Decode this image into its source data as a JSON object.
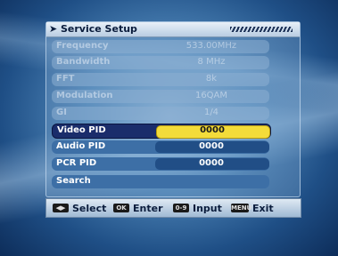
{
  "menu": {
    "title": "Service Setup",
    "rows": [
      {
        "label": "Frequency",
        "value": "533.00MHz"
      },
      {
        "label": "Bandwidth",
        "value": "8 MHz"
      },
      {
        "label": "FFT",
        "value": "8k"
      },
      {
        "label": "Modulation",
        "value": "16QAM"
      },
      {
        "label": "GI",
        "value": "1/4"
      },
      {
        "label": "Video PID",
        "value": "0000"
      },
      {
        "label": "Audio PID",
        "value": "0000"
      },
      {
        "label": "PCR PID",
        "value": "0000"
      },
      {
        "label": "Search",
        "value": ""
      }
    ],
    "selected_row": "Video PID"
  },
  "footer": {
    "hints": [
      {
        "key": "arrows-icon",
        "label": "Select"
      },
      {
        "key": "ok-icon",
        "key_text": "OK",
        "label": "Enter"
      },
      {
        "key": "numeric-icon",
        "key_text": "0-9",
        "label": "Input"
      },
      {
        "key": "menu-icon",
        "key_text": "MENU",
        "label": "Exit"
      }
    ]
  },
  "colors": {
    "highlight_row": "#1a2d6b",
    "highlight_value": "#f3dc3a",
    "title_bar": "#dfe9f3"
  }
}
